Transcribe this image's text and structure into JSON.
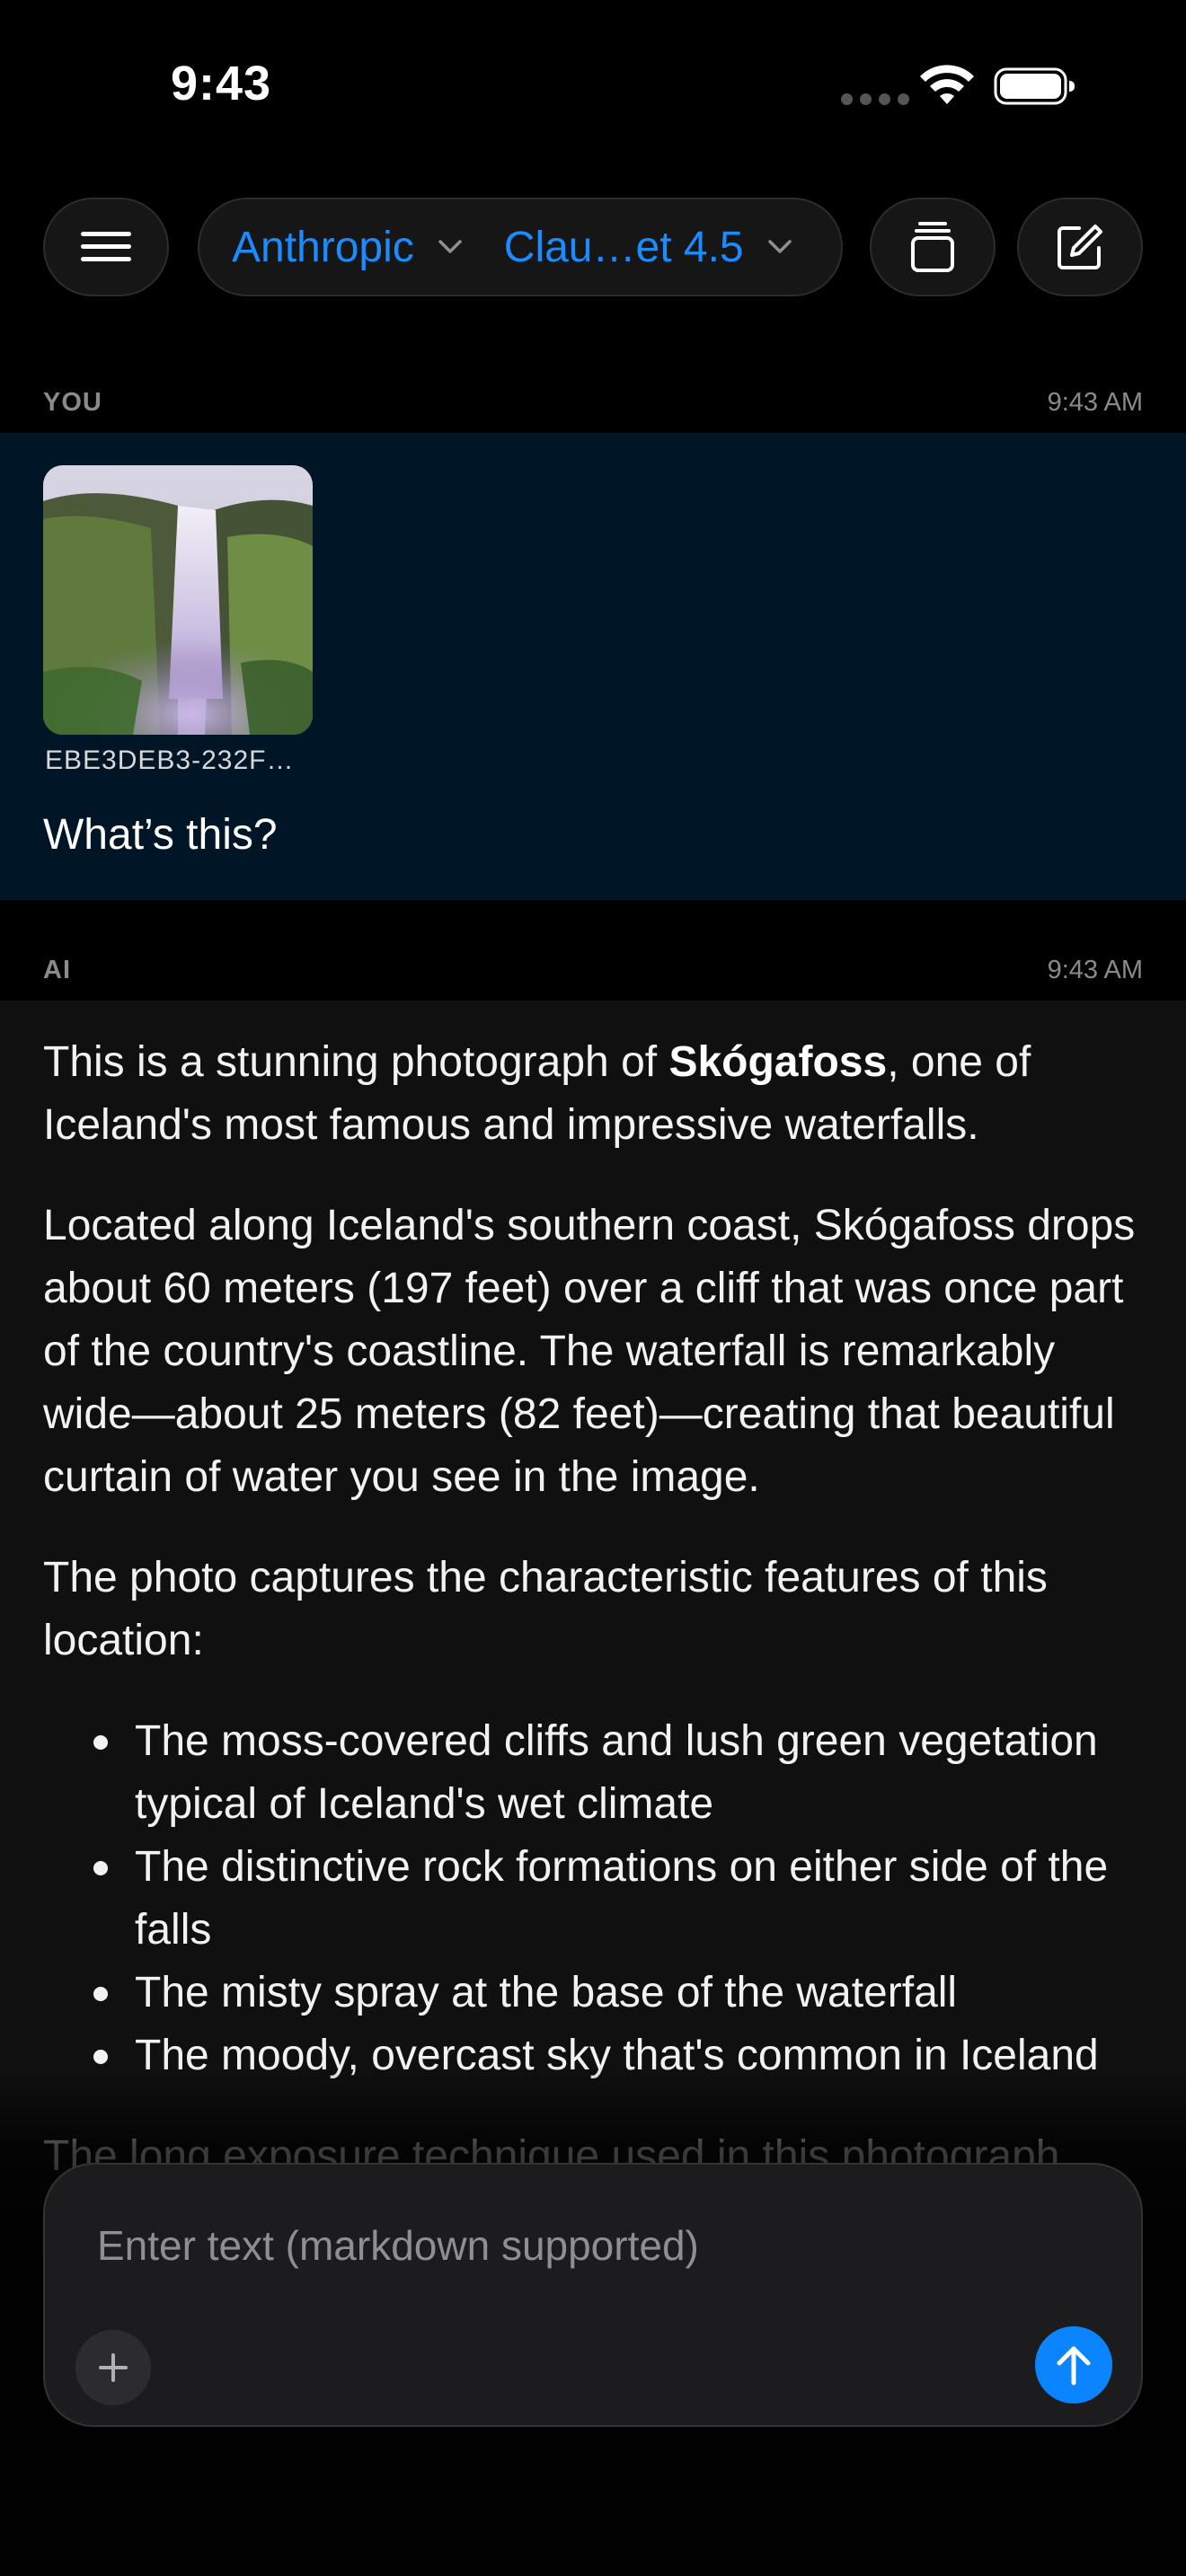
{
  "status_bar": {
    "time": "9:43"
  },
  "toolbar": {
    "provider": "Anthropic",
    "model": "Clau…et 4.5",
    "accent_color": "#1a8cff"
  },
  "conversation": {
    "user_message": {
      "role": "YOU",
      "timestamp": "9:43 AM",
      "attachment_name": "EBE3DEB3-232F…",
      "text": "What’s this?"
    },
    "ai_message": {
      "role": "AI",
      "timestamp": "9:43 AM",
      "p1_before": "This is a stunning photograph of ",
      "p1_bold": "Skógafoss",
      "p1_after": ", one of Iceland's most famous and impressive waterfalls.",
      "p2": "Located along Iceland's southern coast, Skógafoss drops about 60 meters (197 feet) over a cliff that was once part of the country's coastline. The waterfall is remarkably wide—about 25 meters (82 feet)—creating that beautiful curtain of water you see in the image.",
      "p3": "The photo captures the characteristic features of this location:",
      "bullets": [
        "The moss-covered cliffs and lush green vegetation typical of Iceland's wet climate",
        "The distinctive rock formations on either side of the falls",
        "The misty spray at the base of the waterfall",
        "The moody, overcast sky that's common in Iceland"
      ],
      "p4": "The long exposure technique used in this photograph gives the water that smooth, silky appearance."
    }
  },
  "composer": {
    "placeholder": "Enter text (markdown supported)",
    "send_color": "#0a84ff"
  }
}
